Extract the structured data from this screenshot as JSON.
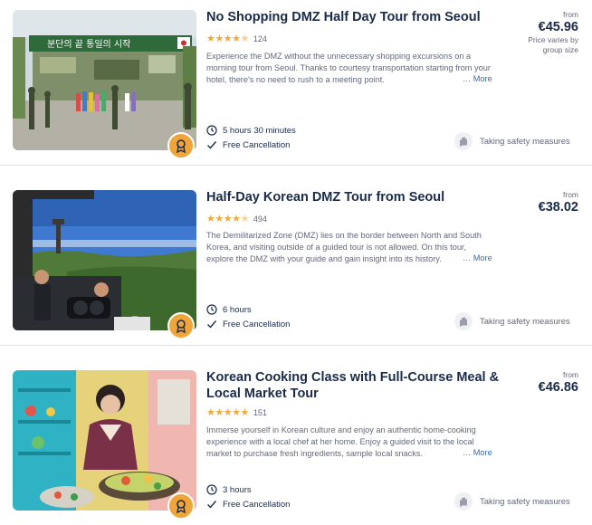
{
  "tours": [
    {
      "title": "No Shopping DMZ Half Day Tour from Seoul",
      "rating": 4.5,
      "review_count": "124",
      "description": "Experience the DMZ without the unnecessary shopping excursions on a morning tour from Seoul. Thanks to courtesy transportation starting from your hotel, there's no need to rush to a meeting point.",
      "more_label": "More",
      "duration": "5 hours 30 minutes",
      "cancellation": "Free Cancellation",
      "safety": "Taking safety measures",
      "price_prefix": "from",
      "price": "€45.96",
      "price_note": "Price varies by group size",
      "sign_text": "분단의 끝  통일의 시작",
      "icons": {
        "wishlist": "heart-icon",
        "badge": "award-badge-icon",
        "duration": "clock-icon",
        "cancellation": "check-icon",
        "safety": "safety-hand-icon"
      }
    },
    {
      "title": "Half-Day Korean DMZ Tour from Seoul",
      "rating": 4.5,
      "review_count": "494",
      "description": "The Demilitarized Zone (DMZ) lies on the border between North and South Korea, and visiting outside of a guided tour is not allowed. On this tour, explore the DMZ with your guide and gain insight into its history.",
      "more_label": "More",
      "duration": "6 hours",
      "cancellation": "Free Cancellation",
      "safety": "Taking safety measures",
      "price_prefix": "from",
      "price": "€38.02",
      "price_note": "",
      "icons": {
        "wishlist": "heart-icon",
        "badge": "award-badge-icon",
        "duration": "clock-icon",
        "cancellation": "check-icon",
        "safety": "safety-hand-icon"
      }
    },
    {
      "title": "Korean Cooking Class with Full-Course Meal & Local Market Tour",
      "rating": 5,
      "review_count": "151",
      "description": "Immerse yourself in Korean culture and enjoy an authentic home-cooking experience with a local chef at her home. Enjoy a guided visit to the local market to purchase fresh ingredients, sample local snacks.",
      "more_label": "More",
      "duration": "3 hours",
      "cancellation": "Free Cancellation",
      "safety": "Taking safety measures",
      "price_prefix": "from",
      "price": "€46.86",
      "price_note": "",
      "icons": {
        "wishlist": "heart-icon",
        "badge": "award-badge-icon",
        "duration": "clock-icon",
        "cancellation": "check-icon",
        "safety": "safety-hand-icon"
      }
    }
  ],
  "colors": {
    "star": "#f3a93a",
    "badge": "#f0a53a",
    "title": "#1a2b49",
    "muted": "#63687a",
    "link": "#3a6bb0"
  }
}
